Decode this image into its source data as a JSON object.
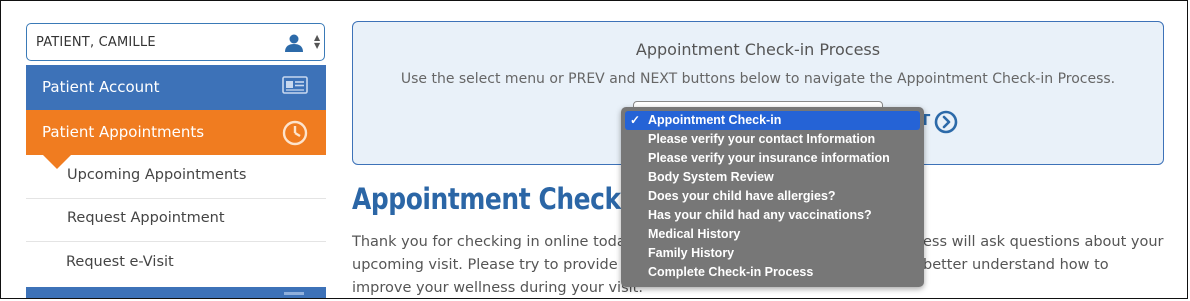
{
  "patient_select": {
    "value": "PATIENT, CAMILLE"
  },
  "sidebar": {
    "account_label": "Patient Account",
    "appointments_label": "Patient Appointments",
    "sub_items": [
      {
        "label": "Upcoming Appointments"
      },
      {
        "label": "Request Appointment"
      },
      {
        "label": "Request e-Visit"
      }
    ]
  },
  "checkin_box": {
    "title": "Appointment Check-in Process",
    "instructions": "Use the select menu or PREV and NEXT buttons below to navigate the Appointment Check-in Process.",
    "next_label_fragment": "T"
  },
  "main": {
    "heading": "Appointment Check-in",
    "intro_lines": [
      "Thank you for checking in online toda",
      "upcoming visit. Please try to provide a",
      "improve your wellness during your visit."
    ],
    "intro_right": [
      "ess will ask questions about your",
      "better understand how to"
    ]
  },
  "dropdown": {
    "options": [
      "Appointment Check-in",
      "Please verify your contact Information",
      "Please verify your insurance information",
      "Body System Review",
      "Does your child have allergies?",
      "Has your child had any vaccinations?",
      "Medical History",
      "Family History",
      "Complete Check-in Process"
    ],
    "selected_index": 0,
    "check_mark": "✓"
  },
  "colors": {
    "blue": "#3d72b8",
    "orange": "#f07c20",
    "heading_blue": "#2b66a6",
    "panel_bg": "#e9f1f9",
    "dropdown_bg": "#777777",
    "dropdown_selected": "#2563d6"
  },
  "icons": {
    "patient_select": "user-icon",
    "patient_account": "id-card-icon",
    "patient_appointments": "clock-icon",
    "next": "chevron-right-circle-icon"
  }
}
